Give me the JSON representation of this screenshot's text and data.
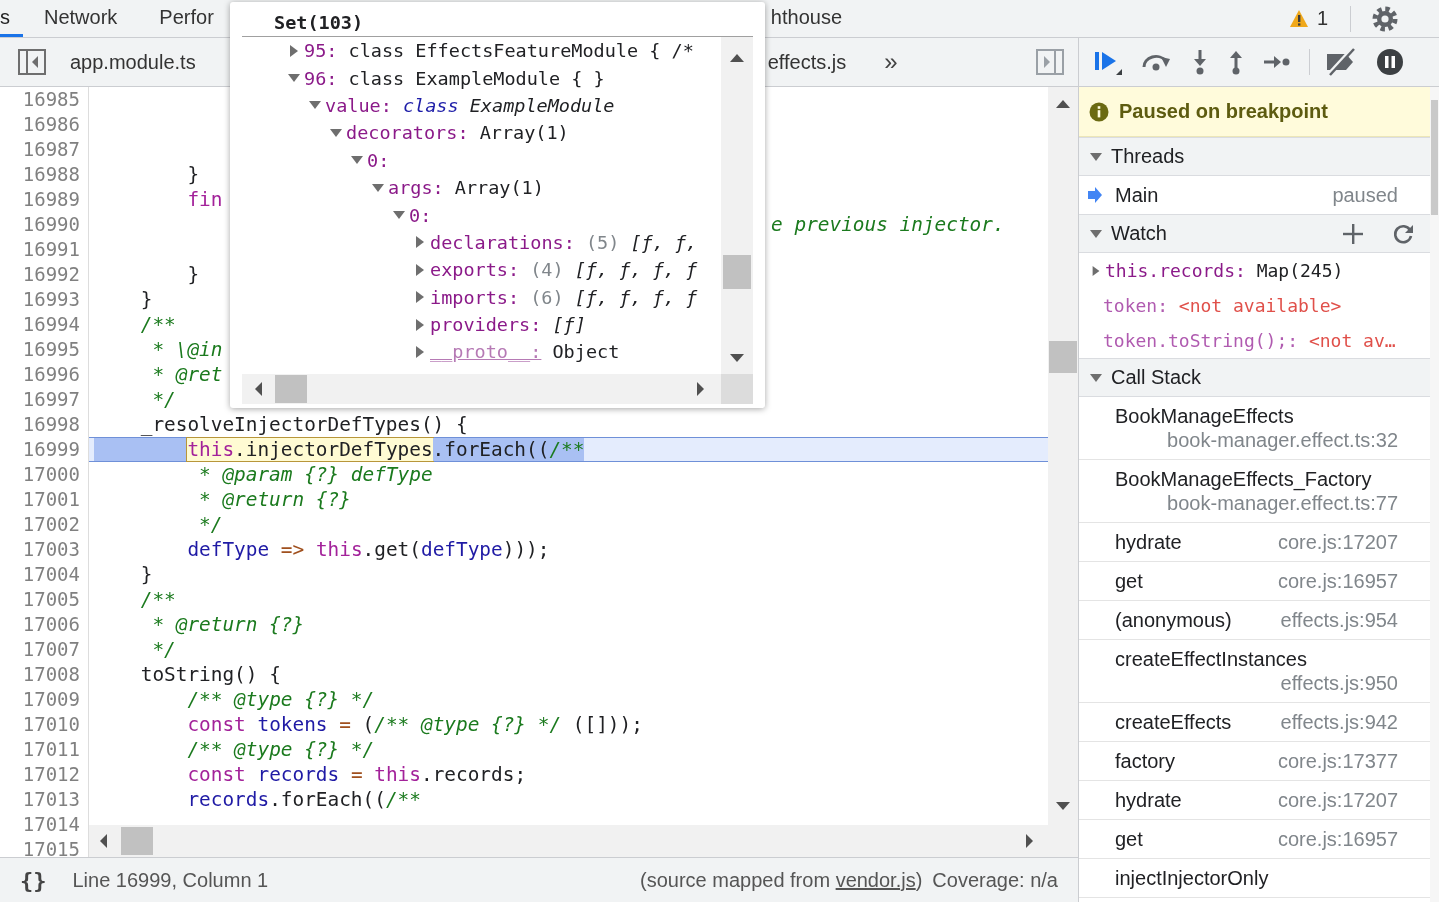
{
  "tabs": [
    {
      "label": "s",
      "selected": true
    },
    {
      "label": "Network",
      "selected": false
    },
    {
      "label": "Perfor",
      "selected": false
    },
    {
      "label": "hthouse",
      "selected": false
    }
  ],
  "issues_count": "1",
  "file_tabs": [
    {
      "label": "app.module.ts",
      "selected": false
    },
    {
      "label": "effects.js",
      "selected": false
    }
  ],
  "more_tabs": "»",
  "code": {
    "lines": [
      {
        "n": "16985",
        "current": false
      },
      {
        "n": "16986",
        "current": false
      },
      {
        "n": "16987",
        "current": false
      },
      {
        "n": "16988",
        "current": false,
        "kind": "code",
        "text": "        }"
      },
      {
        "n": "16989",
        "current": false,
        "kind": "code",
        "text": "        fin"
      },
      {
        "n": "16990",
        "current": false,
        "kind": "comment",
        "text": "                                                          e previous injector."
      },
      {
        "n": "16991",
        "current": false
      },
      {
        "n": "16992",
        "current": false,
        "kind": "code",
        "text": "        }"
      },
      {
        "n": "16993",
        "current": false,
        "kind": "code",
        "text": "    }"
      },
      {
        "n": "16994",
        "current": false,
        "kind": "comment",
        "text": "    /**"
      },
      {
        "n": "16995",
        "current": false,
        "kind": "comment",
        "text": "     * \\@in"
      },
      {
        "n": "16996",
        "current": false,
        "kind": "comment",
        "text": "     * @ret"
      },
      {
        "n": "16997",
        "current": false,
        "kind": "comment",
        "text": "     */"
      },
      {
        "n": "16998",
        "current": false,
        "kind": "code",
        "text": "    _resolveInjectorDefTypes() {"
      },
      {
        "n": "16999",
        "current": true,
        "selected": true,
        "segments": [
          {
            "kind": "hover",
            "text": "        this.injectorDefTypes"
          },
          {
            "kind": "selection",
            "text": ".forEach((/**"
          }
        ]
      },
      {
        "n": "17000",
        "current": false,
        "kind": "comment",
        "text": "         * @param {?} defType"
      },
      {
        "n": "17001",
        "current": false,
        "kind": "comment",
        "text": "         * @return {?}"
      },
      {
        "n": "17002",
        "current": false,
        "kind": "comment",
        "text": "         */"
      },
      {
        "n": "17003",
        "current": false,
        "kind": "code",
        "text": "        defType => this.get(defType)));"
      },
      {
        "n": "17004",
        "current": false,
        "kind": "code",
        "text": "    }"
      },
      {
        "n": "17005",
        "current": false,
        "kind": "comment",
        "text": "    /**"
      },
      {
        "n": "17006",
        "current": false,
        "kind": "comment",
        "text": "     * @return {?}"
      },
      {
        "n": "17007",
        "current": false,
        "kind": "comment",
        "text": "     */"
      },
      {
        "n": "17008",
        "current": false,
        "kind": "code",
        "text": "    toString() {"
      },
      {
        "n": "17009",
        "current": false,
        "kind": "comment",
        "text": "        /** @type {?} */"
      },
      {
        "n": "17010",
        "current": false,
        "kind": "code",
        "text": "        const tokens = (/** @type {?} */ ([]));"
      },
      {
        "n": "17011",
        "current": false,
        "kind": "comment",
        "text": "        /** @type {?} */"
      },
      {
        "n": "17012",
        "current": false,
        "kind": "code",
        "text": "        const records = this.records;"
      },
      {
        "n": "17013",
        "current": false,
        "kind": "code",
        "text": "        records.forEach((/**"
      },
      {
        "n": "17014",
        "current": false
      },
      {
        "n": "17015",
        "current": false
      }
    ]
  },
  "popup": {
    "title": "Set(103)",
    "tree": [
      {
        "key": "95:",
        "value": "class EffectsFeatureModule { /*",
        "kind": "entry",
        "expanded": false
      },
      {
        "key": "96:",
        "value": "class ExampleModule { }",
        "kind": "entry",
        "expanded": true,
        "children": [
          {
            "key": "value:",
            "prefix": "class",
            "value": "ExampleModule",
            "kind": "class",
            "expanded": true,
            "children": [
              {
                "key": "decorators:",
                "value": "Array(1)",
                "kind": "entry",
                "expanded": true,
                "children": [
                  {
                    "key": "0:",
                    "expanded": true,
                    "children": [
                      {
                        "key": "args:",
                        "value": "Array(1)",
                        "kind": "entry",
                        "expanded": true,
                        "children": [
                          {
                            "key": "0:",
                            "expanded": true,
                            "children": [
                              {
                                "key": "declarations:",
                                "note": "(5)",
                                "value": "[ƒ, ƒ,",
                                "kind": "array",
                                "expanded": false
                              },
                              {
                                "key": "exports:",
                                "note": "(4)",
                                "value": "[ƒ, ƒ, ƒ, ƒ",
                                "kind": "array",
                                "expanded": false
                              },
                              {
                                "key": "imports:",
                                "note": "(6)",
                                "value": "[ƒ, ƒ, ƒ, ƒ",
                                "kind": "array",
                                "expanded": false
                              },
                              {
                                "key": "providers:",
                                "value": "[ƒ]",
                                "kind": "array",
                                "expanded": false
                              },
                              {
                                "key": "__proto__:",
                                "value": "Object",
                                "kind": "proto",
                                "expanded": false
                              }
                            ]
                          }
                        ]
                      }
                    ]
                  }
                ]
              }
            ]
          }
        ]
      }
    ]
  },
  "paused_banner": "Paused on breakpoint",
  "threads": {
    "title": "Threads",
    "expanded": true,
    "items": [
      {
        "name": "Main",
        "status": "paused",
        "selected": true
      }
    ]
  },
  "watch": {
    "title": "Watch",
    "expanded": true,
    "items": [
      {
        "kind": "object",
        "expression": "this.records:",
        "value": "Map(245)",
        "expanded": false
      },
      {
        "kind": "unavailable",
        "expression": "token:",
        "value": "<not available>"
      },
      {
        "kind": "unavailable",
        "expression": "token.toString();:",
        "value": "<not av…"
      }
    ]
  },
  "call_stack": {
    "title": "Call Stack",
    "expanded": true,
    "frames": [
      {
        "name": "BookManageEffects",
        "location": "book-manager.effect.ts:32"
      },
      {
        "name": "BookManageEffects_Factory",
        "location": "book-manager.effect.ts:77"
      },
      {
        "name": "hydrate",
        "location": "core.js:17207"
      },
      {
        "name": "get",
        "location": "core.js:16957"
      },
      {
        "name": "(anonymous)",
        "location": "effects.js:954"
      },
      {
        "name": "createEffectInstances",
        "location": "effects.js:950"
      },
      {
        "name": "createEffects",
        "location": "effects.js:942"
      },
      {
        "name": "factory",
        "location": "core.js:17377"
      },
      {
        "name": "hydrate",
        "location": "core.js:17207"
      },
      {
        "name": "get",
        "location": "core.js:16957"
      },
      {
        "name": "injectInjectorOnly"
      }
    ]
  },
  "status_bar": {
    "format_button": "{}",
    "position": "Line 16999, Column 1",
    "source_prefix": "(source mapped from ",
    "source_link": "vendor.js",
    "source_suffix": ")",
    "coverage": "Coverage: n/a"
  }
}
